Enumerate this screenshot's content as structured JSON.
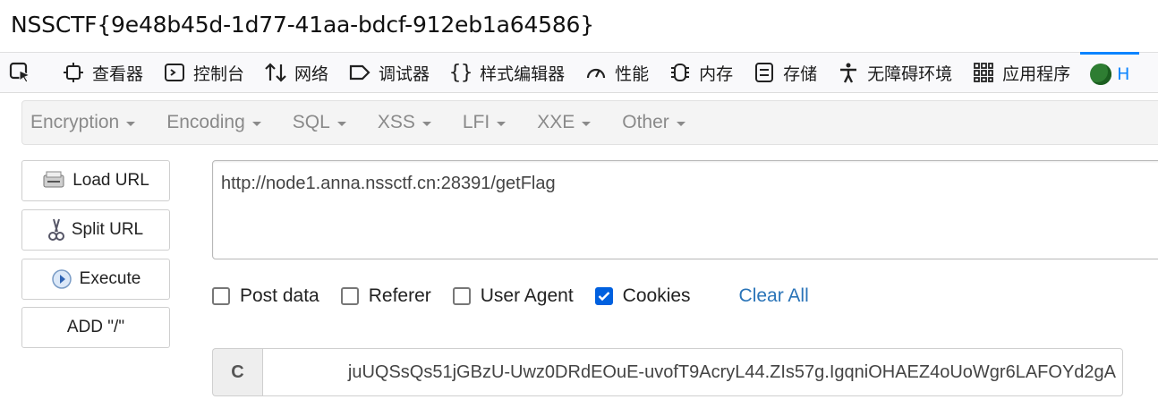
{
  "page": {
    "flag_text": "NSSCTF{9e48b45d-1d77-41aa-bdcf-912eb1a64586}"
  },
  "devtools": {
    "tabs": [
      {
        "label": "查看器",
        "icon": "inspector-icon"
      },
      {
        "label": "控制台",
        "icon": "console-icon"
      },
      {
        "label": "网络",
        "icon": "network-icon"
      },
      {
        "label": "调试器",
        "icon": "debugger-icon"
      },
      {
        "label": "样式编辑器",
        "icon": "style-editor-icon"
      },
      {
        "label": "性能",
        "icon": "performance-icon"
      },
      {
        "label": "内存",
        "icon": "memory-icon"
      },
      {
        "label": "存储",
        "icon": "storage-icon"
      },
      {
        "label": "无障碍环境",
        "icon": "accessibility-icon"
      },
      {
        "label": "应用程序",
        "icon": "application-icon"
      }
    ],
    "active_tab_letter": "H",
    "accent_color": "#0a84ff"
  },
  "hackbar": {
    "menus": [
      "Encryption",
      "Encoding",
      "SQL",
      "XSS",
      "LFI",
      "XXE",
      "Other"
    ],
    "buttons": {
      "load_url": "Load URL",
      "split_url": "Split URL",
      "execute": "Execute",
      "add_slash": "ADD \"/\""
    },
    "url_value": "http://node1.anna.nssctf.cn:28391/getFlag",
    "options": {
      "post_data": {
        "label": "Post data",
        "checked": false
      },
      "referer": {
        "label": "Referer",
        "checked": false
      },
      "user_agent": {
        "label": "User Agent",
        "checked": false
      },
      "cookies": {
        "label": "Cookies",
        "checked": true
      }
    },
    "clear_all": "Clear All",
    "cookie_label": "C",
    "cookie_value": "juUQSsQs51jGBzU-Uwz0DRdEOuE-uvofT9AcryL44.ZIs57g.IgqniOHAEZ4oUoWgr6LAFOYd2gA"
  }
}
